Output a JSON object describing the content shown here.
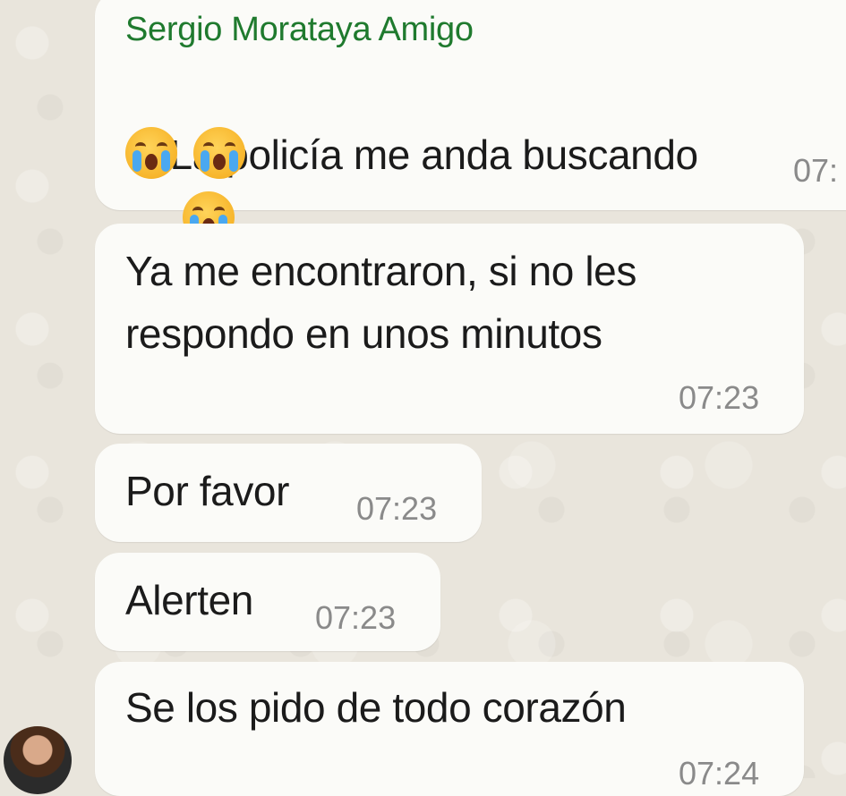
{
  "chat": {
    "sender_name": "Sergio Morataya Amigo",
    "messages": [
      {
        "line1": "La policía me anda buscando",
        "emoji_name": "loudly-crying-face",
        "time": "07:"
      },
      {
        "line1": "Ya me encontraron, si no les",
        "line2": "respondo en unos minutos",
        "time": "07:23"
      },
      {
        "text": "Por favor",
        "time": "07:23"
      },
      {
        "text": "Alerten",
        "time": "07:23"
      },
      {
        "text": "Se los pido de todo corazón",
        "time": "07:24"
      }
    ]
  },
  "colors": {
    "chat_background": "#e9e5dc",
    "bubble": "#fbfbf8",
    "sender_name": "#1f7a2e",
    "timestamp": "#8a8a8a"
  }
}
